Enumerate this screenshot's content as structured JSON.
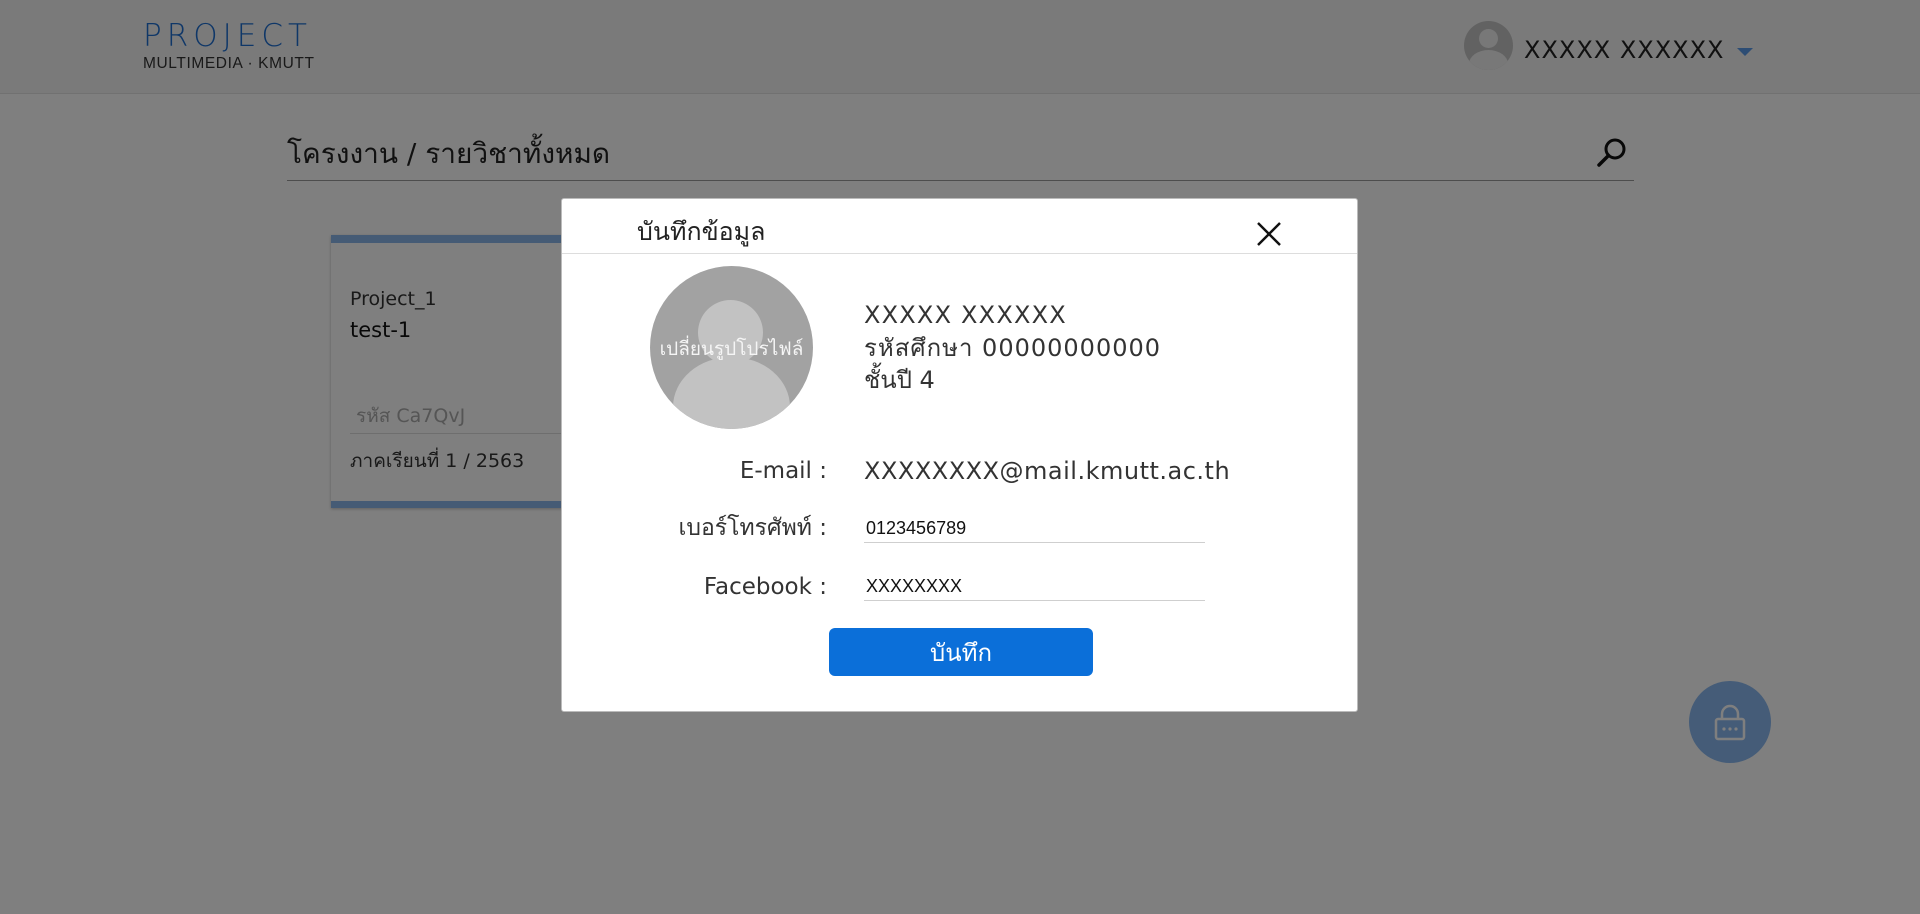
{
  "header": {
    "logo_top": "PROJECT",
    "logo_bottom": "MULTIMEDIA · KMUTT",
    "user_name": "XXXXX XXXXXX"
  },
  "page": {
    "breadcrumb": "โครงงาน / รายวิชาทั้งหมด"
  },
  "card": {
    "code": "Project_1",
    "name": "test-1",
    "subject_code": "รหัส Ca7QvJ",
    "term": "ภาคเรียนที่ 1 / 2563"
  },
  "modal": {
    "title": "บันทึกข้อมูล",
    "change_photo_label": "เปลี่ยนรูปโปรไฟล์",
    "name": "XXXXX XXXXXX",
    "student_id": "รหัสศึกษา 00000000000",
    "year": "ชั้นปี 4",
    "email_label": "E-mail :",
    "email_value": "XXXXXXXX@mail.kmutt.ac.th",
    "phone_label": "เบอร์โทรศัพท์ :",
    "phone_value": "0123456789",
    "facebook_label": "Facebook :",
    "facebook_value": "XXXXXXXX",
    "save_label": "บันทึก"
  },
  "colors": {
    "accent": "#0b6fd9",
    "card_border": "#8ab6ea",
    "overlay": "rgba(0,0,0,0.5)"
  },
  "icons": [
    "search-icon",
    "close-icon",
    "lock-icon",
    "chevron-down-icon",
    "user-avatar-icon"
  ]
}
